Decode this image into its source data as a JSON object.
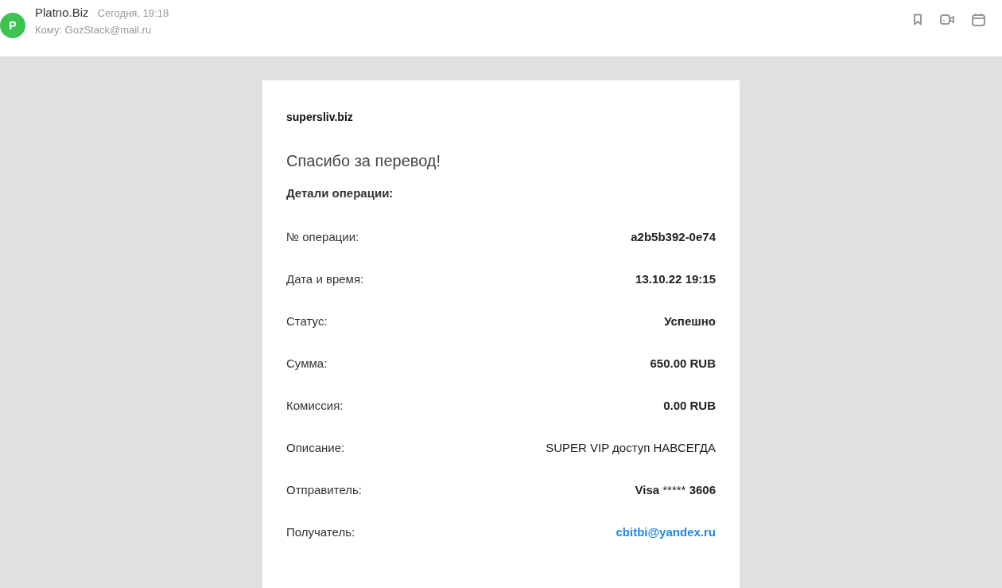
{
  "header": {
    "avatar": "P",
    "sender": "Platno.Biz",
    "date": "Сегодня, 19:18",
    "recipient": "Кому: GozStack@mail.ru"
  },
  "letter": {
    "site": "supersliv.biz",
    "heading": "Спасибо за перевод!",
    "subheading": "Детали операции:",
    "rows": [
      {
        "label": "№ операции:",
        "kind": "text",
        "parts": [
          {
            "text": "a2b5b392-0e74",
            "bold": true
          }
        ]
      },
      {
        "label": "Дата и время:",
        "kind": "text",
        "parts": [
          {
            "text": "13.10.22 19:15",
            "bold": true
          }
        ]
      },
      {
        "label": "Статус:",
        "kind": "text",
        "parts": [
          {
            "text": "Успешно",
            "bold": true
          }
        ]
      },
      {
        "label": "Сумма:",
        "kind": "text",
        "parts": [
          {
            "text": "650.00 RUB",
            "bold": true
          }
        ]
      },
      {
        "label": "Комиссия:",
        "kind": "text",
        "parts": [
          {
            "text": "0.00 RUB",
            "bold": true
          }
        ]
      },
      {
        "label": "Описание:",
        "kind": "text",
        "parts": [
          {
            "text": "SUPER VIP доступ НАВСЕГДА",
            "bold": false
          }
        ]
      },
      {
        "label": "Отправитель:",
        "kind": "text",
        "parts": [
          {
            "text": "Visa",
            "bold": true
          },
          {
            "text": " ***** ",
            "bold": false
          },
          {
            "text": "3606",
            "bold": true
          }
        ]
      },
      {
        "label": "Получатель:",
        "kind": "link",
        "parts": [
          {
            "text": "cbitbi@yandex.ru",
            "bold": true
          }
        ]
      }
    ]
  }
}
